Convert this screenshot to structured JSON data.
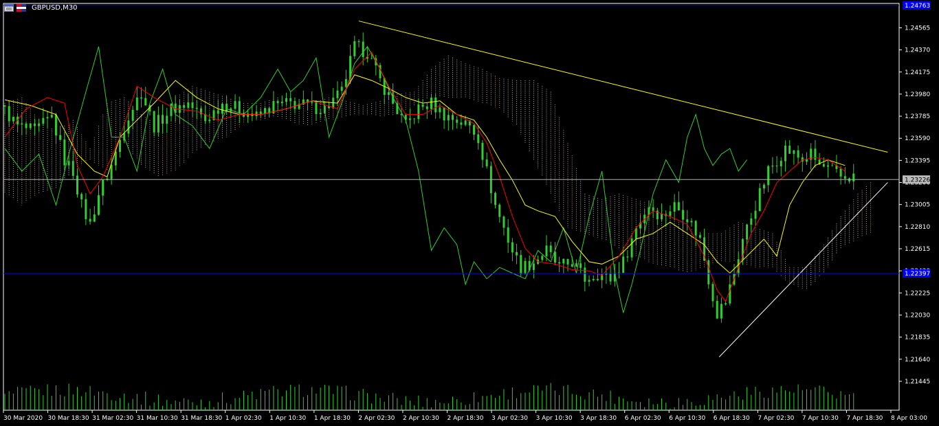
{
  "window": {
    "title": "GBPUSD,M30"
  },
  "colors": {
    "background": "#000000",
    "frame": "#ffffff",
    "candles": "#32cd32",
    "chikou": "#32cd32",
    "tenkan": "#ff0000",
    "kijun": "#ffff00",
    "cloud_bull": "#ffdab9",
    "cloud_bear": "#ffffff",
    "trendline": "#ffff00",
    "support_line": "#ffffff",
    "price_line": "#b0b0b0",
    "blue_level": "#0000ff",
    "volume": "#32cd32",
    "axis_text": "#ffffff"
  },
  "chart_data": {
    "type": "candlestick",
    "symbol": "GBPUSD",
    "timeframe": "M30",
    "y_ticks": [
      "1.24565",
      "1.24370",
      "1.24175",
      "1.23980",
      "1.23785",
      "1.23590",
      "1.23395",
      "1.23200",
      "1.23005",
      "1.22810",
      "1.22615",
      "1.22420",
      "1.22225",
      "1.22030",
      "1.21835",
      "1.21640",
      "1.21445"
    ],
    "ylim": [
      1.2119,
      1.2478
    ],
    "x_ticks": [
      "30 Mar 2020",
      "30 Mar 18:30",
      "31 Mar 02:30",
      "31 Mar 10:30",
      "31 Mar 18:30",
      "1 Apr 02:30",
      "1 Apr 10:30",
      "1 Apr 18:30",
      "2 Apr 02:30",
      "2 Apr 10:30",
      "2 Apr 18:30",
      "3 Apr 02:30",
      "3 Apr 10:30",
      "3 Apr 18:30",
      "6 Apr 02:30",
      "6 Apr 10:30",
      "6 Apr 18:30",
      "7 Apr 02:30",
      "7 Apr 10:30",
      "7 Apr 18:30",
      "8 Apr 03:00"
    ],
    "current_price": "1.23226",
    "upper_level_label": "1.24763",
    "blue_level_label": "1.22397",
    "close_path": [
      [
        0,
        1.2388
      ],
      [
        4,
        1.237
      ],
      [
        8,
        1.2365
      ],
      [
        12,
        1.2378
      ],
      [
        15,
        1.234
      ],
      [
        17,
        1.233
      ],
      [
        19,
        1.23
      ],
      [
        21,
        1.2283
      ],
      [
        23,
        1.231
      ],
      [
        26,
        1.2335
      ],
      [
        30,
        1.238
      ],
      [
        33,
        1.24
      ],
      [
        36,
        1.237
      ],
      [
        40,
        1.2385
      ],
      [
        44,
        1.239
      ],
      [
        48,
        1.2375
      ],
      [
        52,
        1.239
      ],
      [
        56,
        1.2385
      ],
      [
        60,
        1.2378
      ],
      [
        64,
        1.2388
      ],
      [
        68,
        1.239
      ],
      [
        72,
        1.2388
      ],
      [
        76,
        1.2385
      ],
      [
        80,
        1.24
      ],
      [
        83,
        1.244
      ],
      [
        86,
        1.2435
      ],
      [
        89,
        1.241
      ],
      [
        92,
        1.239
      ],
      [
        95,
        1.237
      ],
      [
        98,
        1.2385
      ],
      [
        101,
        1.239
      ],
      [
        104,
        1.238
      ],
      [
        107,
        1.2375
      ],
      [
        110,
        1.237
      ],
      [
        112,
        1.236
      ],
      [
        114,
        1.233
      ],
      [
        116,
        1.23
      ],
      [
        118,
        1.228
      ],
      [
        120,
        1.226
      ],
      [
        122,
        1.2245
      ],
      [
        125,
        1.225
      ],
      [
        128,
        1.226
      ],
      [
        131,
        1.2245
      ],
      [
        134,
        1.225
      ],
      [
        137,
        1.2235
      ],
      [
        140,
        1.224
      ],
      [
        143,
        1.2235
      ],
      [
        146,
        1.225
      ],
      [
        149,
        1.228
      ],
      [
        152,
        1.23
      ],
      [
        155,
        1.229
      ],
      [
        158,
        1.23
      ],
      [
        161,
        1.229
      ],
      [
        164,
        1.227
      ],
      [
        166,
        1.2235
      ],
      [
        168,
        1.2205
      ],
      [
        170,
        1.2215
      ],
      [
        172,
        1.224
      ],
      [
        174,
        1.227
      ],
      [
        176,
        1.229
      ],
      [
        178,
        1.231
      ],
      [
        180,
        1.233
      ],
      [
        182,
        1.234
      ],
      [
        184,
        1.235
      ],
      [
        186,
        1.2345
      ],
      [
        188,
        1.234
      ],
      [
        190,
        1.2345
      ],
      [
        192,
        1.2335
      ],
      [
        195,
        1.233
      ],
      [
        197,
        1.2325
      ]
    ],
    "tenkan_path": [
      [
        0,
        1.236
      ],
      [
        5,
        1.2385
      ],
      [
        10,
        1.2395
      ],
      [
        14,
        1.239
      ],
      [
        17,
        1.2335
      ],
      [
        20,
        1.231
      ],
      [
        23,
        1.2325
      ],
      [
        27,
        1.236
      ],
      [
        31,
        1.2405
      ],
      [
        35,
        1.2395
      ],
      [
        40,
        1.2385
      ],
      [
        45,
        1.2383
      ],
      [
        50,
        1.2375
      ],
      [
        55,
        1.238
      ],
      [
        60,
        1.238
      ],
      [
        66,
        1.2385
      ],
      [
        72,
        1.2392
      ],
      [
        78,
        1.2385
      ],
      [
        82,
        1.242
      ],
      [
        86,
        1.2435
      ],
      [
        90,
        1.2405
      ],
      [
        94,
        1.238
      ],
      [
        98,
        1.238
      ],
      [
        102,
        1.2388
      ],
      [
        106,
        1.238
      ],
      [
        110,
        1.2372
      ],
      [
        113,
        1.2355
      ],
      [
        116,
        1.2325
      ],
      [
        119,
        1.229
      ],
      [
        122,
        1.2262
      ],
      [
        125,
        1.225
      ],
      [
        129,
        1.2248
      ],
      [
        133,
        1.2243
      ],
      [
        137,
        1.2242
      ],
      [
        140,
        1.2238
      ],
      [
        144,
        1.2255
      ],
      [
        148,
        1.228
      ],
      [
        152,
        1.2295
      ],
      [
        156,
        1.229
      ],
      [
        160,
        1.2283
      ],
      [
        164,
        1.2255
      ],
      [
        167,
        1.2225
      ],
      [
        169,
        1.2215
      ],
      [
        172,
        1.2245
      ],
      [
        175,
        1.2275
      ],
      [
        178,
        1.2295
      ],
      [
        181,
        1.232
      ],
      [
        184,
        1.233
      ],
      [
        187,
        1.234
      ],
      [
        190,
        1.2342
      ],
      [
        193,
        1.234
      ],
      [
        197,
        1.233
      ]
    ],
    "kijun_path": [
      [
        0,
        1.2393
      ],
      [
        6,
        1.2388
      ],
      [
        12,
        1.238
      ],
      [
        17,
        1.2345
      ],
      [
        21,
        1.233
      ],
      [
        24,
        1.2325
      ],
      [
        27,
        1.236
      ],
      [
        31,
        1.2375
      ],
      [
        35,
        1.239
      ],
      [
        40,
        1.241
      ],
      [
        45,
        1.2395
      ],
      [
        50,
        1.2385
      ],
      [
        55,
        1.238
      ],
      [
        60,
        1.238
      ],
      [
        66,
        1.2385
      ],
      [
        72,
        1.2392
      ],
      [
        78,
        1.239
      ],
      [
        82,
        1.2415
      ],
      [
        86,
        1.241
      ],
      [
        90,
        1.2403
      ],
      [
        94,
        1.2395
      ],
      [
        98,
        1.239
      ],
      [
        102,
        1.2392
      ],
      [
        106,
        1.238
      ],
      [
        110,
        1.2375
      ],
      [
        113,
        1.236
      ],
      [
        116,
        1.234
      ],
      [
        119,
        1.2322
      ],
      [
        122,
        1.23
      ],
      [
        125,
        1.2295
      ],
      [
        129,
        1.229
      ],
      [
        133,
        1.2268
      ],
      [
        137,
        1.225
      ],
      [
        140,
        1.2248
      ],
      [
        144,
        1.2255
      ],
      [
        148,
        1.227
      ],
      [
        152,
        1.2275
      ],
      [
        156,
        1.2285
      ],
      [
        160,
        1.2275
      ],
      [
        164,
        1.2265
      ],
      [
        167,
        1.225
      ],
      [
        170,
        1.224
      ],
      [
        174,
        1.2255
      ],
      [
        178,
        1.227
      ],
      [
        181,
        1.2255
      ],
      [
        184,
        1.23
      ],
      [
        187,
        1.232
      ],
      [
        190,
        1.2335
      ],
      [
        193,
        1.234
      ],
      [
        197,
        1.2335
      ]
    ],
    "chikou_path": [
      [
        0,
        1.235
      ],
      [
        4,
        1.233
      ],
      [
        8,
        1.2345
      ],
      [
        12,
        1.23
      ],
      [
        15,
        1.2345
      ],
      [
        19,
        1.24
      ],
      [
        22,
        1.244
      ],
      [
        25,
        1.236
      ],
      [
        28,
        1.236
      ],
      [
        31,
        1.233
      ],
      [
        34,
        1.239
      ],
      [
        37,
        1.242
      ],
      [
        40,
        1.238
      ],
      [
        44,
        1.237
      ],
      [
        48,
        1.235
      ],
      [
        52,
        1.2385
      ],
      [
        56,
        1.238
      ],
      [
        60,
        1.2395
      ],
      [
        64,
        1.242
      ],
      [
        67,
        1.24
      ],
      [
        70,
        1.241
      ],
      [
        73,
        1.243
      ],
      [
        76,
        1.236
      ],
      [
        79,
        1.239
      ],
      [
        82,
        1.2425
      ],
      [
        85,
        1.244
      ],
      [
        88,
        1.242
      ],
      [
        91,
        1.2395
      ],
      [
        94,
        1.2375
      ],
      [
        97,
        1.233
      ],
      [
        100,
        1.226
      ],
      [
        103,
        1.228
      ],
      [
        106,
        1.2265
      ],
      [
        108,
        1.223
      ],
      [
        110,
        1.225
      ],
      [
        113,
        1.2235
      ],
      [
        116,
        1.2245
      ],
      [
        119,
        1.224
      ],
      [
        122,
        1.2235
      ],
      [
        125,
        1.226
      ],
      [
        128,
        1.225
      ],
      [
        131,
        1.228
      ],
      [
        134,
        1.224
      ],
      [
        137,
        1.229
      ],
      [
        140,
        1.233
      ],
      [
        143,
        1.224
      ],
      [
        145,
        1.2205
      ],
      [
        147,
        1.223
      ],
      [
        149,
        1.226
      ],
      [
        152,
        1.231
      ],
      [
        155,
        1.234
      ],
      [
        158,
        1.232
      ],
      [
        160,
        1.236
      ],
      [
        162,
        1.238
      ],
      [
        164,
        1.235
      ],
      [
        166,
        1.2335
      ],
      [
        168,
        1.2345
      ],
      [
        170,
        1.235
      ],
      [
        172,
        1.233
      ],
      [
        174,
        1.234
      ]
    ],
    "cloud_points": [
      [
        0,
        1.231,
        1.239
      ],
      [
        4,
        1.23,
        1.2395
      ],
      [
        8,
        1.231,
        1.2375
      ],
      [
        12,
        1.2315,
        1.2365
      ],
      [
        16,
        1.233,
        1.2375
      ],
      [
        20,
        1.234,
        1.235
      ],
      [
        24,
        1.233,
        1.239
      ],
      [
        28,
        1.2355,
        1.2395
      ],
      [
        32,
        1.2335,
        1.238
      ],
      [
        36,
        1.2325,
        1.237
      ],
      [
        40,
        1.233,
        1.2395
      ],
      [
        44,
        1.2345,
        1.2405
      ],
      [
        48,
        1.2355,
        1.24
      ],
      [
        52,
        1.236,
        1.2395
      ],
      [
        56,
        1.2372,
        1.239
      ],
      [
        60,
        1.2375,
        1.239
      ],
      [
        64,
        1.2378,
        1.2395
      ],
      [
        68,
        1.2372,
        1.2395
      ],
      [
        72,
        1.237,
        1.239
      ],
      [
        76,
        1.2375,
        1.2395
      ],
      [
        80,
        1.2378,
        1.2392
      ],
      [
        84,
        1.238,
        1.2388
      ],
      [
        88,
        1.2378,
        1.2392
      ],
      [
        92,
        1.238,
        1.2398
      ],
      [
        96,
        1.2388,
        1.24
      ],
      [
        100,
        1.2395,
        1.242
      ],
      [
        104,
        1.2395,
        1.2432
      ],
      [
        108,
        1.2395,
        1.2425
      ],
      [
        112,
        1.239,
        1.242
      ],
      [
        116,
        1.2385,
        1.2412
      ],
      [
        120,
        1.237,
        1.241
      ],
      [
        124,
        1.234,
        1.241
      ],
      [
        128,
        1.231,
        1.24
      ],
      [
        132,
        1.228,
        1.2355
      ],
      [
        136,
        1.2275,
        1.231
      ],
      [
        140,
        1.227,
        1.2305
      ],
      [
        144,
        1.2262,
        1.231
      ],
      [
        148,
        1.2255,
        1.2305
      ],
      [
        152,
        1.2248,
        1.23
      ],
      [
        156,
        1.2245,
        1.229
      ],
      [
        160,
        1.224,
        1.228
      ],
      [
        164,
        1.2245,
        1.2275
      ],
      [
        168,
        1.225,
        1.2275
      ],
      [
        172,
        1.225,
        1.2285
      ],
      [
        176,
        1.2245,
        1.228
      ],
      [
        180,
        1.2245,
        1.2275
      ],
      [
        184,
        1.223,
        1.2245
      ],
      [
        188,
        1.2225,
        1.2245
      ],
      [
        192,
        1.224,
        1.2265
      ],
      [
        196,
        1.2262,
        1.229
      ],
      [
        200,
        1.227,
        1.231
      ],
      [
        203,
        1.2275,
        1.232
      ]
    ],
    "trendlines": [
      {
        "kind": "resistance",
        "start": [
          83.0,
          1.24625
        ],
        "end": [
          207.0,
          1.23467
        ]
      },
      {
        "kind": "support",
        "start": [
          167.5,
          1.2166
        ],
        "end": [
          207.0,
          1.232
        ]
      }
    ],
    "volume_max": 100
  }
}
